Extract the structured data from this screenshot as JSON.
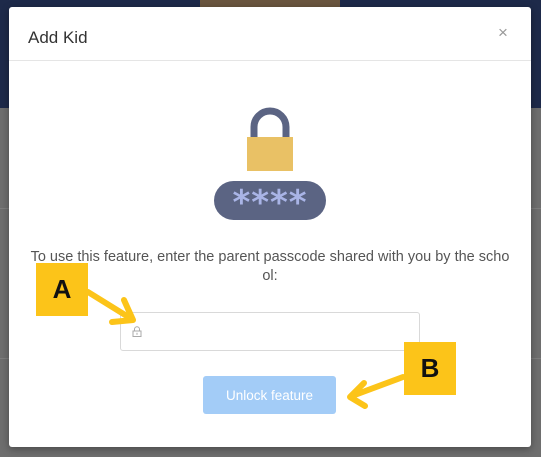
{
  "dialog": {
    "title": "Add Kid",
    "close_glyph": "×",
    "message": "To use this feature, enter the parent passcode shared with you by the school:",
    "passcode": {
      "value": "",
      "placeholder": "",
      "icon": "lock-icon"
    },
    "unlock_label": "Unlock feature",
    "masked_passcode": "****"
  },
  "annotations": {
    "a": "A",
    "b": "B"
  },
  "colors": {
    "padlock_body": "#e9c165",
    "padlock_shackle": "#5b6483",
    "pill": "#5b6483",
    "pill_stars": "#a9b4e6",
    "button_disabled": "#a3ccf7",
    "callout": "#fcc419"
  }
}
